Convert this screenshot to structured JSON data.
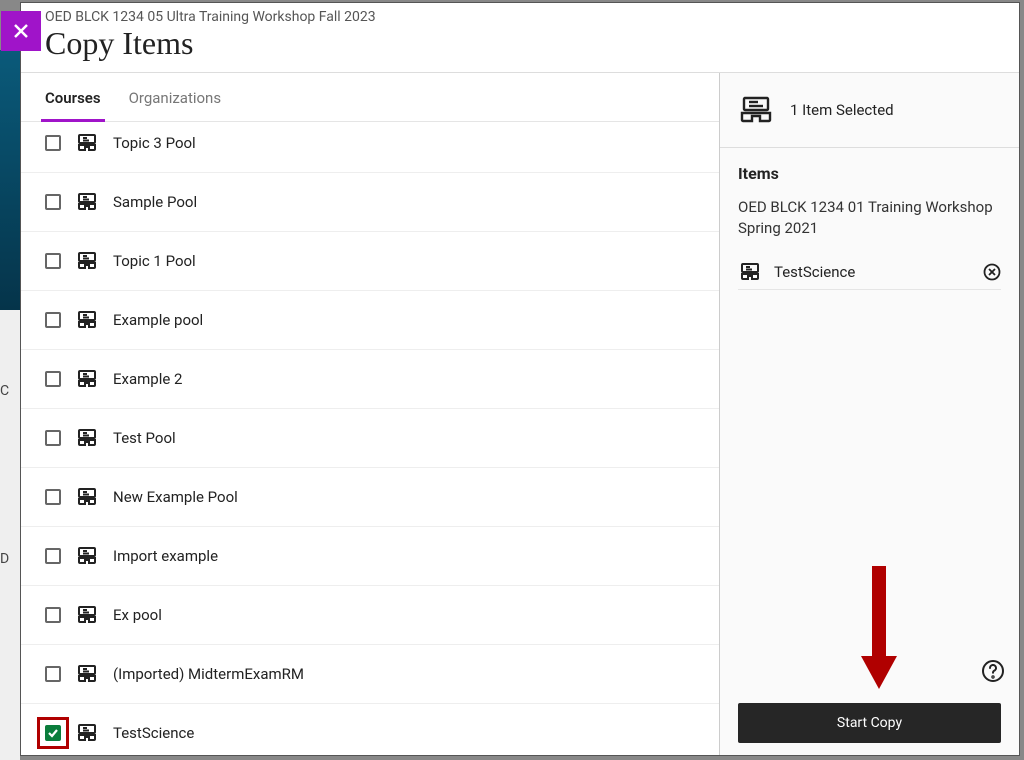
{
  "header": {
    "context": "OED BLCK 1234 05 Ultra Training Workshop Fall 2023",
    "title": "Copy Items"
  },
  "tabs": {
    "courses": "Courses",
    "organizations": "Organizations",
    "active": "courses"
  },
  "items": [
    {
      "label": "Topic 3 Pool",
      "checked": false
    },
    {
      "label": "Sample Pool",
      "checked": false
    },
    {
      "label": "Topic 1 Pool",
      "checked": false
    },
    {
      "label": "Example pool",
      "checked": false
    },
    {
      "label": "Example 2",
      "checked": false
    },
    {
      "label": "Test Pool",
      "checked": false
    },
    {
      "label": "New Example Pool",
      "checked": false
    },
    {
      "label": "Import example",
      "checked": false
    },
    {
      "label": "Ex pool",
      "checked": false
    },
    {
      "label": "(Imported) MidtermExamRM",
      "checked": false
    },
    {
      "label": "TestScience",
      "checked": true,
      "highlight": true
    }
  ],
  "summary": {
    "count_label": "1 Item Selected",
    "items_heading": "Items",
    "source_course": "OED BLCK 1234 01 Training Workshop Spring 2021",
    "selected": [
      {
        "label": "TestScience"
      }
    ]
  },
  "actions": {
    "start_copy": "Start Copy"
  },
  "icons": {
    "close": "close-icon",
    "pool": "question-bank-icon",
    "inbox": "inbox-icon",
    "remove": "remove-circle-icon",
    "help": "help-circle-icon"
  }
}
